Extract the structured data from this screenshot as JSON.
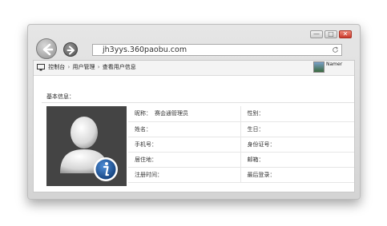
{
  "browser": {
    "url": "jh3yys.360paobu.com",
    "controls": {
      "minimize": "—",
      "maximize": "□",
      "close": "✕"
    }
  },
  "breadcrumb": {
    "items": [
      "控制台",
      "用户管理",
      "查看用户信息"
    ],
    "separator": "›"
  },
  "user_chip": {
    "name": "Namer"
  },
  "section": {
    "title": "基本信息："
  },
  "profile": {
    "fields": [
      {
        "label": "昵称：",
        "value": "赛会通管理员"
      },
      {
        "label": "性别：",
        "value": ""
      },
      {
        "label": "姓名：",
        "value": ""
      },
      {
        "label": "生日：",
        "value": ""
      },
      {
        "label": "手机号：",
        "value": ""
      },
      {
        "label": "身份证号：",
        "value": ""
      },
      {
        "label": "居住地：",
        "value": ""
      },
      {
        "label": "邮箱：",
        "value": ""
      },
      {
        "label": "注册时间：",
        "value": ""
      },
      {
        "label": "最后登录：",
        "value": ""
      }
    ]
  },
  "colors": {
    "avatar_bg": "#444444",
    "info_badge": "#1c5aa6",
    "close_button": "#c9392b"
  },
  "icons": [
    "back-arrow-icon",
    "forward-arrow-icon",
    "refresh-icon",
    "monitor-icon",
    "default-user-avatar-icon",
    "info-badge-icon"
  ]
}
